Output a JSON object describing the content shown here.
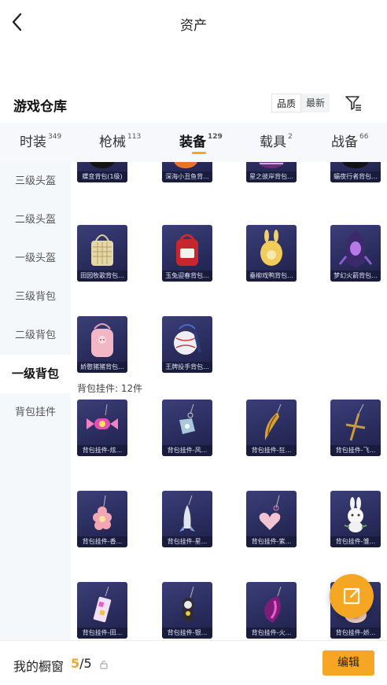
{
  "header": {
    "title": "资产"
  },
  "section": {
    "title": "游戏仓库",
    "sort_options": [
      "品质",
      "最新"
    ]
  },
  "tabs": [
    {
      "label": "时装",
      "count": "349"
    },
    {
      "label": "枪械",
      "count": "113"
    },
    {
      "label": "装备",
      "count": "129"
    },
    {
      "label": "载具",
      "count": "2"
    },
    {
      "label": "战备",
      "count": "66"
    }
  ],
  "sidebar": {
    "items": [
      "三级头盔",
      "二级头盔",
      "一级头盔",
      "三级背包",
      "二级背包",
      "一级背包",
      "背包挂件"
    ]
  },
  "backpacks": {
    "top_row": [
      "蝶变背包(1级)",
      "深海小丑鱼背...",
      "星之彼岸背包...",
      "蝠夜行者背包..."
    ],
    "row2": [
      "田园牧歌背包...",
      "玉兔迎春背包...",
      "垂柳戏鸭背包...",
      "梦幻火箭背包..."
    ],
    "row3": [
      "娇憨猪猪背包...",
      "王牌投手背包..."
    ]
  },
  "pendants": {
    "count_label": "背包挂件: 12件",
    "row1": [
      "背包挂件-炫...",
      "背包挂件-风...",
      "背包挂件-狂...",
      "背包挂件-飞..."
    ],
    "row2": [
      "背包挂件-香...",
      "背包挂件-星...",
      "背包挂件-紫...",
      "背包挂件-雏..."
    ],
    "row3": [
      "背包挂件-田...",
      "背包挂件-银...",
      "背包挂件-火...",
      "背包挂件-娇..."
    ]
  },
  "showcase": {
    "label": "我的橱窗",
    "current": "5",
    "total": "/5",
    "edit_label": "编辑"
  },
  "colors": {
    "accent": "#f5a623",
    "card_bg": "#2a2d5e"
  }
}
